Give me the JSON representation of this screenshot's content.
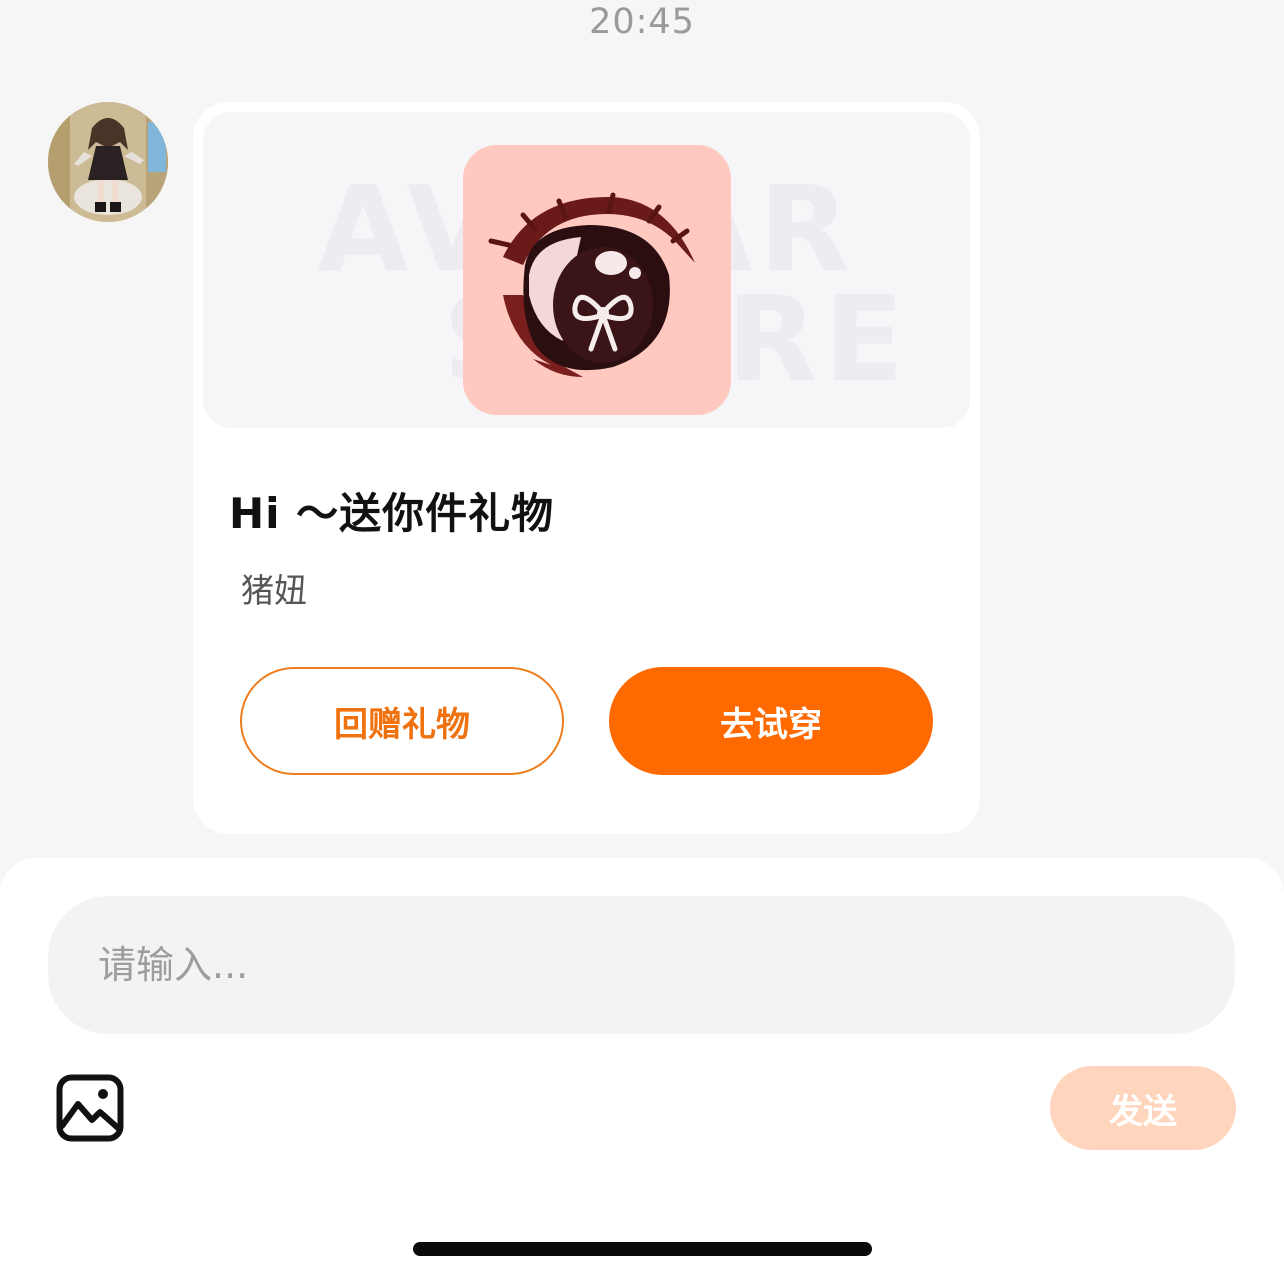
{
  "timestamp": "20:45",
  "message": {
    "avatar_icon": "user-avatar-anime-girl",
    "banner_watermark_line1": "AVATAR",
    "banner_watermark_line2": "STORE",
    "gift_icon": "anime-eye-item",
    "title": "Hi ～送你件礼物",
    "sender": "猪妞",
    "return_gift_label": "回赠礼物",
    "try_on_label": "去试穿"
  },
  "composer": {
    "placeholder": "请输入...",
    "image_icon": "image-icon",
    "send_label": "发送"
  },
  "colors": {
    "accent": "#ff6a00",
    "accent_light": "#ffd6bd",
    "gift_bg": "#ffc9c0"
  }
}
